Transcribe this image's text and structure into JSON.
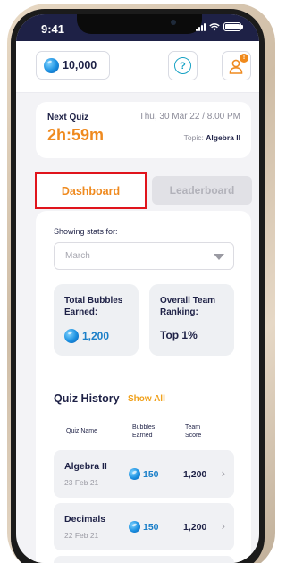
{
  "status_bar": {
    "time": "9:41"
  },
  "header": {
    "bubble_balance": "10,000",
    "help_glyph": "?",
    "notification_count": "!"
  },
  "next_quiz": {
    "label": "Next Quiz",
    "countdown": "2h:59m",
    "datetime": "Thu, 30 Mar 22 / 8.00 PM",
    "topic_prefix": "Topic:",
    "topic": "Algebra II"
  },
  "tabs": {
    "dashboard": "Dashboard",
    "leaderboard": "Leaderboard",
    "selected": "Dashboard"
  },
  "stats": {
    "showing_label": "Showing stats for:",
    "month_value": "March",
    "bubbles_card": {
      "title": "Total Bubbles Earned:",
      "value": "1,200"
    },
    "ranking_card": {
      "title": "Overall Team Ranking:",
      "value": "Top 1%"
    }
  },
  "quiz_history": {
    "title": "Quiz History",
    "show_all": "Show All",
    "columns": [
      "Quiz Name",
      "Bubbles Earned",
      "Team Score"
    ],
    "rows": [
      {
        "name": "Algebra II",
        "date": "23 Feb 21",
        "bubbles": "150",
        "score": "1,200"
      },
      {
        "name": "Decimals",
        "date": "22 Feb 21",
        "bubbles": "150",
        "score": "1,200"
      }
    ]
  },
  "colors": {
    "navy": "#1e2146",
    "orange": "#ef8a1f",
    "blue": "#1a7fc8",
    "teal": "#17a2c4",
    "highlight_red": "#e0141c"
  },
  "icons": [
    "bubble-icon",
    "help-icon",
    "profile-icon",
    "chevron-down-icon",
    "chevron-right-icon",
    "signal-icon",
    "wifi-icon",
    "battery-icon"
  ]
}
